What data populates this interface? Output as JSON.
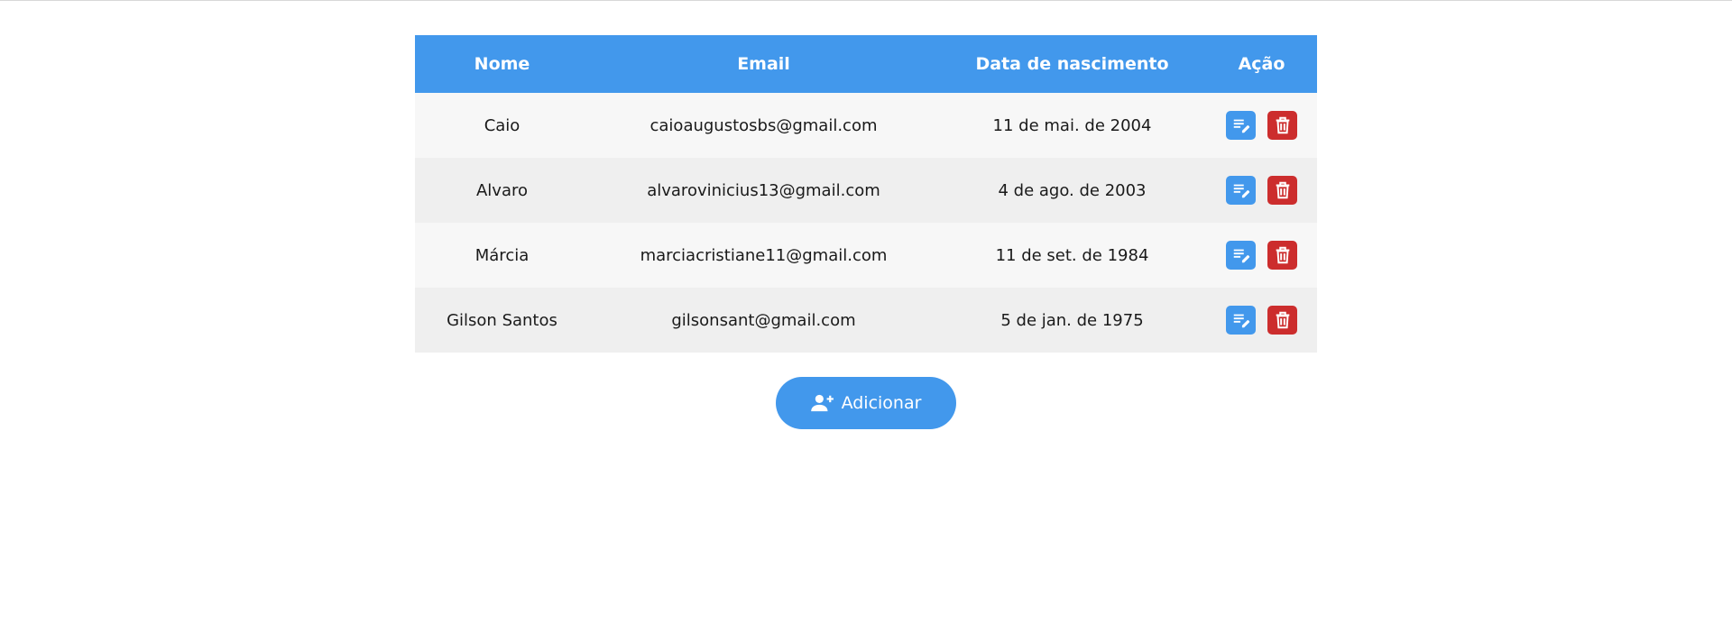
{
  "table": {
    "headers": {
      "nome": "Nome",
      "email": "Email",
      "data": "Data de nascimento",
      "acao": "Ação"
    },
    "rows": [
      {
        "nome": "Caio",
        "email": "caioaugustosbs@gmail.com",
        "data": "11 de mai. de 2004"
      },
      {
        "nome": "Alvaro",
        "email": "alvarovinicius13@gmail.com",
        "data": "4 de ago. de 2003"
      },
      {
        "nome": "Márcia",
        "email": "marciacristiane11@gmail.com",
        "data": "11 de set. de 1984"
      },
      {
        "nome": "Gilson Santos",
        "email": "gilsonsant@gmail.com",
        "data": "5 de jan. de 1975"
      }
    ],
    "row_actions": {
      "edit_icon": "edit-note-icon",
      "delete_icon": "trash-icon"
    }
  },
  "add_button": {
    "label": "Adicionar",
    "icon": "person-add-icon"
  },
  "colors": {
    "accent": "#4298ec",
    "danger": "#cc2d2d"
  }
}
